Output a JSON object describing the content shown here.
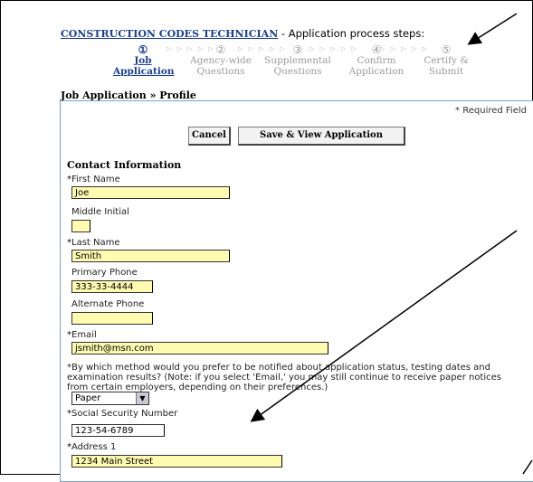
{
  "header": {
    "job_title": "CONSTRUCTION CODES TECHNICIAN",
    "process_suffix": " - Application process steps:"
  },
  "steps": [
    {
      "num": "①",
      "line1": "Job",
      "line2": "Application",
      "active": true
    },
    {
      "num": "②",
      "line1": "Agency-wide",
      "line2": "Questions",
      "active": false
    },
    {
      "num": "③",
      "line1": "Supplemental",
      "line2": "Questions",
      "active": false
    },
    {
      "num": "④",
      "line1": "Confirm",
      "line2": "Application",
      "active": false
    },
    {
      "num": "⑤",
      "line1": "Certify &",
      "line2": "Submit",
      "active": false
    }
  ],
  "step_arrows": "▷ ▷ ▷ ▷ ▷",
  "breadcrumb": "Job Application » Profile",
  "form": {
    "required_note": "* Required Field",
    "cancel_label": "Cancel",
    "save_label": "Save & View Application",
    "section_title": "Contact Information",
    "first_name": {
      "label": "First Name",
      "required": "*",
      "value": "Joe"
    },
    "middle_initial": {
      "label": "Middle Initial",
      "value": ""
    },
    "last_name": {
      "label": "Last Name",
      "required": "*",
      "value": "Smith"
    },
    "primary_phone": {
      "label": "Primary Phone",
      "value": "333-33-4444"
    },
    "alternate_phone": {
      "label": "Alternate Phone",
      "value": ""
    },
    "email": {
      "label": "Email",
      "required": "*",
      "value": "jsmith@msn.com"
    },
    "notify_method": {
      "required": "*",
      "question": "By which method would you prefer to be notified about application status, testing dates and examination results? (Note: if you select 'Email,' you may still continue to receive paper notices from certain employers, depending on their preferences.)",
      "selected": "Paper"
    },
    "ssn": {
      "label": "Social Security Number",
      "required": "*",
      "value": "123-54-6789"
    },
    "address1": {
      "label": "Address 1",
      "required": "*",
      "value": "1234 Main Street"
    }
  },
  "colors": {
    "link": "#1a3f8f",
    "field_bg": "#fffbb0",
    "panel_border": "#7f9ec7",
    "inactive_step": "#9a9a9a"
  }
}
